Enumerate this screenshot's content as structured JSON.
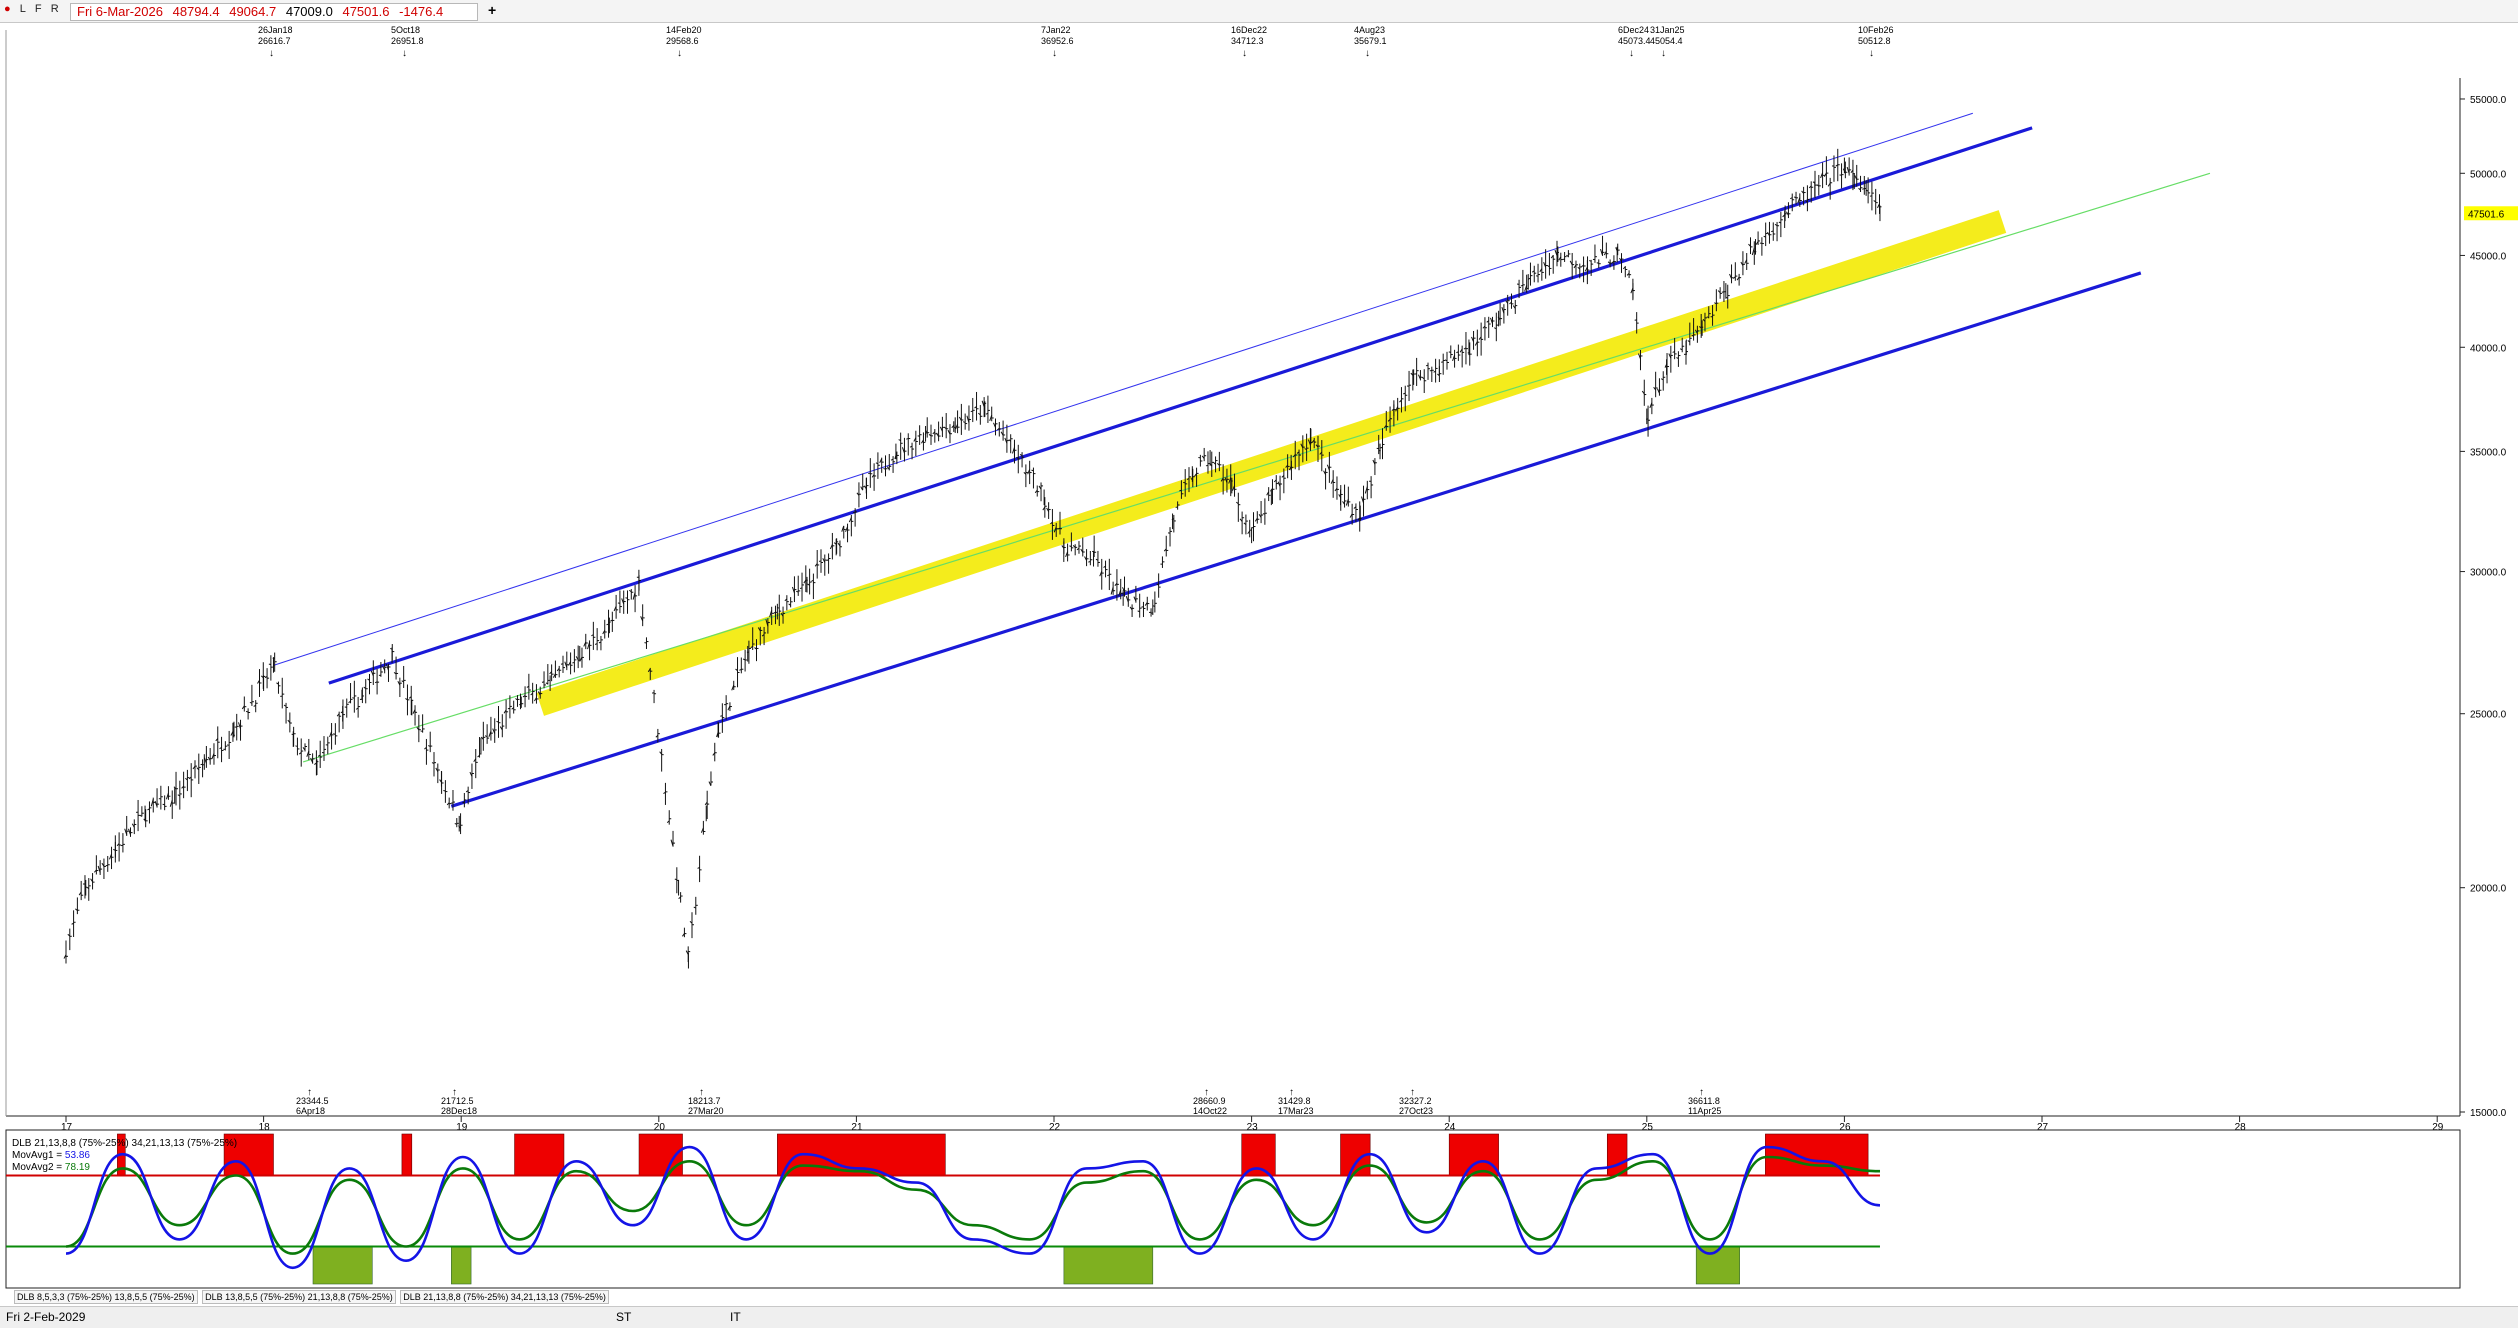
{
  "toolbar": {
    "icons": [
      "L",
      "F",
      "R"
    ],
    "date": "Fri 6-Mar-2026",
    "open": "48794.4",
    "high": "49064.7",
    "low": "47009.0",
    "close": "47501.6",
    "change": "-1476.4",
    "add_label": "+"
  },
  "colors": {
    "channel": "#1a1ad8",
    "channel_thin": "#3333ee",
    "band": "#f4ec1c",
    "midline": "#66dd66",
    "oscillator": "#1414e6",
    "signal": "#0a7a0a",
    "overbought_box": "#ee0000",
    "oversold_box": "#7fb020",
    "overbought_line": "#d00000",
    "oversold_line": "#0a8a0a",
    "price_marker": "#ffff00"
  },
  "chart_data": [
    {
      "type": "line",
      "style": "OHLC bars",
      "title": "",
      "ylim": [
        15000,
        56500
      ],
      "log_scale": true,
      "y_ticks": [
        "55000.0",
        "50000.0",
        "45000.0",
        "40000.0",
        "35000.0",
        "30000.0",
        "25000.0",
        "20000.0",
        "15000.0"
      ],
      "y_tick_values": [
        55000,
        50000,
        45000,
        40000,
        35000,
        30000,
        25000,
        20000,
        15000
      ],
      "x_ticks": [
        "17",
        "18",
        "19",
        "20",
        "21",
        "22",
        "23",
        "24",
        "25",
        "26",
        "27",
        "28",
        "29"
      ],
      "last_price_label": "47501.6",
      "x": [
        2017.0,
        2017.1,
        2017.25,
        2017.4,
        2017.55,
        2017.7,
        2017.85,
        2018.0,
        2018.05,
        2018.15,
        2018.27,
        2018.4,
        2018.5,
        2018.65,
        2018.75,
        2018.9,
        2018.99,
        2019.1,
        2019.3,
        2019.45,
        2019.6,
        2019.75,
        2019.9,
        2020.1,
        2020.15,
        2020.24,
        2020.3,
        2020.45,
        2020.6,
        2020.75,
        2020.9,
        2021.05,
        2021.2,
        2021.35,
        2021.5,
        2021.65,
        2021.8,
        2021.95,
        2022.05,
        2022.2,
        2022.35,
        2022.5,
        2022.6,
        2022.7,
        2022.79,
        2022.9,
        2023.0,
        2023.1,
        2023.2,
        2023.3,
        2023.45,
        2023.55,
        2023.65,
        2023.72,
        2023.82,
        2023.95,
        2024.1,
        2024.25,
        2024.4,
        2024.55,
        2024.7,
        2024.85,
        2024.93,
        2025.0,
        2025.1,
        2025.2,
        2025.28,
        2025.4,
        2025.55,
        2025.7,
        2025.85,
        2026.0,
        2026.05,
        2026.11,
        2026.18
      ],
      "series": [
        {
          "values": [
            18500,
            20000,
            21000,
            22000,
            22500,
            23500,
            24500,
            26000,
            26616,
            24200,
            23344,
            25000,
            25600,
            26951,
            25200,
            23000,
            21712,
            24000,
            25400,
            26000,
            27000,
            28000,
            29568,
            20000,
            18213,
            22000,
            24500,
            27000,
            28500,
            29500,
            31000,
            33500,
            35000,
            35800,
            36200,
            36952,
            35000,
            33000,
            31000,
            30500,
            29000,
            28660,
            32000,
            34000,
            34712,
            33500,
            31429,
            33000,
            34500,
            35679,
            33000,
            32327,
            35000,
            37000,
            38500,
            39000,
            40000,
            41500,
            43500,
            45073,
            44500,
            45054,
            43000,
            36611,
            39000,
            40000,
            41000,
            43000,
            45500,
            47500,
            49000,
            50512,
            49500,
            49064,
            47501
          ]
        }
      ],
      "annotations_top": [
        {
          "date": "26Jan18",
          "value": "26616.7"
        },
        {
          "date": "5Oct18",
          "value": "26951.8"
        },
        {
          "date": "14Feb20",
          "value": "29568.6"
        },
        {
          "date": "7Jan22",
          "value": "36952.6"
        },
        {
          "date": "16Dec22",
          "value": "34712.3"
        },
        {
          "date": "4Aug23",
          "value": "35679.1"
        },
        {
          "date": "6Dec24",
          "value": "45073.4"
        },
        {
          "date": "31Jan25",
          "value": "45054.4"
        },
        {
          "date": "10Feb26",
          "value": "50512.8"
        }
      ],
      "annotations_bottom": [
        {
          "value": "23344.5",
          "date": "6Apr18"
        },
        {
          "value": "21712.5",
          "date": "28Dec18"
        },
        {
          "value": "18213.7",
          "date": "27Mar20"
        },
        {
          "value": "28660.9",
          "date": "14Oct22"
        },
        {
          "value": "31429.8",
          "date": "17Mar23"
        },
        {
          "value": "32327.2",
          "date": "27Oct23"
        },
        {
          "value": "36611.8",
          "date": "11Apr25"
        }
      ],
      "trendlines": [
        {
          "name": "upper-channel",
          "from": [
            2018.33,
            26000
          ],
          "to": [
            2026.95,
            53000
          ]
        },
        {
          "name": "upper-thin",
          "from": [
            2018.05,
            26600
          ],
          "to": [
            2026.65,
            54000
          ]
        },
        {
          "name": "lower-channel",
          "from": [
            2018.95,
            22200
          ],
          "to": [
            2027.5,
            44000
          ]
        },
        {
          "name": "yellow-band",
          "from": [
            2019.4,
            25300
          ],
          "to": [
            2026.8,
            47000
          ]
        },
        {
          "name": "green-midline",
          "from": [
            2018.2,
            23500
          ],
          "to": [
            2027.85,
            50000
          ]
        }
      ]
    },
    {
      "type": "line",
      "title": "DLB 21,13,8,8 (75%-25%) 34,21,13,13 (75%-25%)",
      "legend": [
        {
          "label": "MovAvg1",
          "value": "53.86"
        },
        {
          "label": "MovAvg2",
          "value": "78.19"
        }
      ],
      "ylim": [
        0,
        100
      ],
      "levels": [
        75,
        25
      ],
      "series": [
        {
          "name": "MovAvg1",
          "values": [
            20,
            90,
            30,
            85,
            10,
            80,
            15,
            88,
            20,
            85,
            40,
            95,
            30,
            90,
            80,
            70,
            30,
            20,
            80,
            85,
            20,
            80,
            30,
            90,
            35,
            85,
            20,
            80,
            90,
            20,
            95,
            85,
            54
          ]
        },
        {
          "name": "MovAvg2",
          "values": [
            25,
            80,
            40,
            75,
            20,
            72,
            25,
            80,
            30,
            78,
            50,
            85,
            40,
            82,
            78,
            65,
            40,
            30,
            70,
            78,
            30,
            72,
            40,
            82,
            42,
            78,
            30,
            72,
            85,
            30,
            88,
            82,
            78
          ]
        }
      ],
      "overbought_zones": [
        [
          2017.26,
          2017.3
        ],
        [
          2017.8,
          2018.05
        ],
        [
          2018.7,
          2018.75
        ],
        [
          2019.27,
          2019.52
        ],
        [
          2019.9,
          2020.12
        ],
        [
          2020.6,
          2021.45
        ],
        [
          2022.95,
          2023.12
        ],
        [
          2023.45,
          2023.6
        ],
        [
          2024.0,
          2024.25
        ],
        [
          2024.8,
          2024.9
        ],
        [
          2025.6,
          2026.12
        ]
      ],
      "oversold_zones": [
        [
          2018.25,
          2018.55
        ],
        [
          2018.95,
          2019.05
        ],
        [
          2022.05,
          2022.5
        ],
        [
          2025.25,
          2025.47
        ]
      ]
    }
  ],
  "tabs": [
    "DLB 8,5,3,3 (75%-25%) 13,8,5,5 (75%-25%)",
    "DLB 13,8,5,5 (75%-25%) 21,13,8,8 (75%-25%)",
    "DLB 21,13,8,8 (75%-25%) 34,21,13,13 (75%-25%)"
  ],
  "status": {
    "date": "Fri 2-Feb-2029",
    "left_tag": "ST",
    "right_tag": "IT"
  }
}
